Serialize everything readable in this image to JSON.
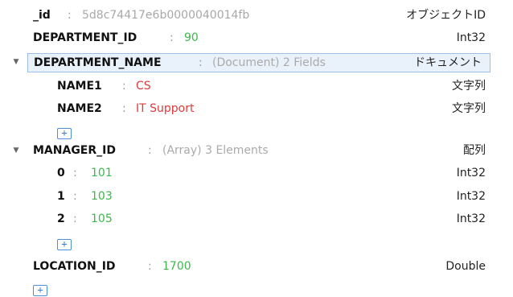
{
  "fields": {
    "id": {
      "key": "_id",
      "sep": ":",
      "value": "5d8c74417e6b0000040014fb",
      "type": "オブジェクトID"
    },
    "department_id": {
      "key": "DEPARTMENT_ID",
      "sep": ":",
      "value": "90",
      "type": "Int32"
    },
    "department_name": {
      "key": "DEPARTMENT_NAME",
      "sep": ":",
      "summary": "(Document) 2 Fields",
      "type": "ドキュメント",
      "toggle_icon": "caret-down-icon",
      "children": [
        {
          "key": "NAME1",
          "sep": ":",
          "value": "CS",
          "type": "文字列"
        },
        {
          "key": "NAME2",
          "sep": ":",
          "value": "IT Support",
          "type": "文字列"
        }
      ]
    },
    "manager_id": {
      "key": "MANAGER_ID",
      "sep": ":",
      "summary": "(Array) 3 Elements",
      "type": "配列",
      "toggle_icon": "caret-down-icon",
      "children": [
        {
          "key": "0",
          "sep": ":",
          "value": "101",
          "type": "Int32"
        },
        {
          "key": "1",
          "sep": ":",
          "value": "103",
          "type": "Int32"
        },
        {
          "key": "2",
          "sep": ":",
          "value": "105",
          "type": "Int32"
        }
      ]
    },
    "location_id": {
      "key": "LOCATION_ID",
      "sep": ":",
      "value": "1700",
      "type": "Double"
    }
  },
  "add_button": {
    "label": "+",
    "icon": "plus-icon"
  },
  "toggle_glyph": "▼",
  "colors": {
    "string_value": "#e23a3a",
    "number_value": "#3bb84a",
    "objectid_value": "#a8a8a8",
    "selection_bg": "#e9f1fa",
    "selection_border": "#9fbfe6",
    "add_button_border": "#4d8fd6"
  }
}
